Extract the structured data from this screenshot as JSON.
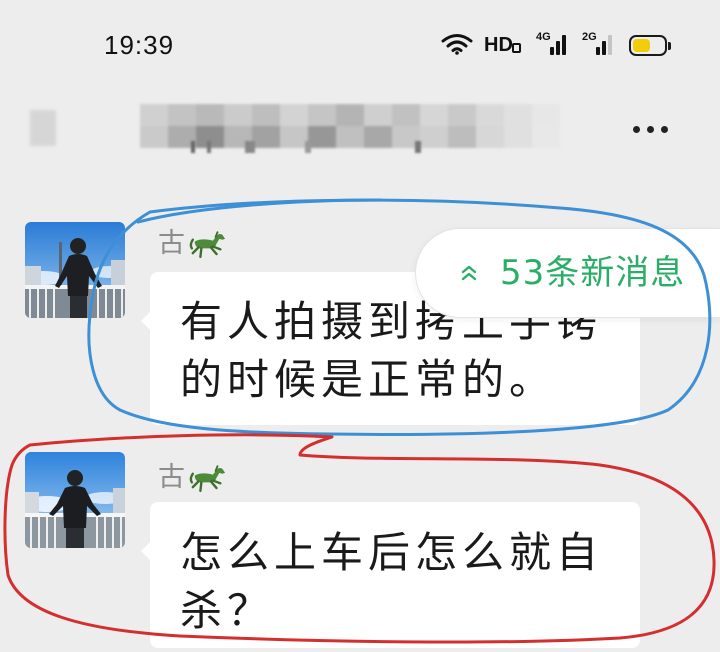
{
  "status_bar": {
    "time": "19:39",
    "wifi_icon": "wifi-icon",
    "hd_label": "HD",
    "sim1_network": "4G",
    "sim1_signal_level": 3,
    "sim2_network": "2G",
    "sim2_signal_level": 2,
    "battery_level": 0.55,
    "battery_fill_color": "#f2cd0a"
  },
  "header": {
    "more_icon": "more-horizontal-icon"
  },
  "new_messages_pill": {
    "icon": "double-chevron-up-icon",
    "label": "53条新消息",
    "color": "#2aae67"
  },
  "messages": [
    {
      "avatar_icon": "avatar-photo",
      "sender": "古",
      "sender_badge_icon": "horse-icon",
      "text": "有人拍摄到拷上手铐的时候是正常的。"
    },
    {
      "avatar_icon": "avatar-photo",
      "sender": "古",
      "sender_badge_icon": "horse-icon",
      "text": "怎么上车后怎么就自杀？"
    }
  ],
  "annotations": {
    "blue_loop_color": "#3d8fd6",
    "red_loop_color": "#d42f2f"
  },
  "theme": {
    "background": "#ededed",
    "bubble": "#ffffff",
    "message_text": "#1a1a1a",
    "sender_name": "#8c8c8c"
  }
}
